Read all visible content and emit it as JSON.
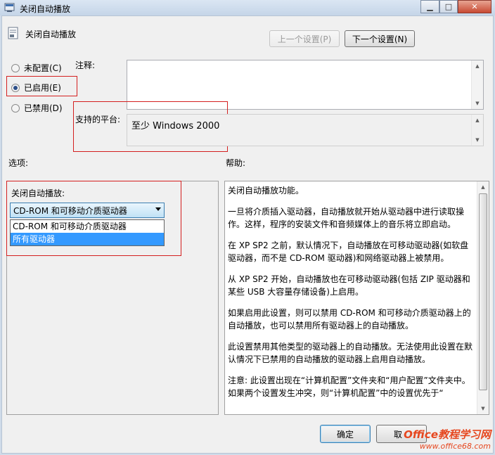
{
  "window": {
    "title": "关闭自动播放"
  },
  "policy": {
    "name": "关闭自动播放"
  },
  "nav": {
    "prev": "上一个设置(P)",
    "next": "下一个设置(N)"
  },
  "state": {
    "not_configured": "未配置(C)",
    "enabled": "已启用(E)",
    "disabled": "已禁用(D)",
    "selected": "enabled"
  },
  "comment": {
    "label": "注释:",
    "value": ""
  },
  "platform": {
    "label": "支持的平台:",
    "value": "至少 Windows 2000"
  },
  "options": {
    "header": "选项:",
    "label": "关闭自动播放:",
    "combo_value": "CD-ROM 和可移动介质驱动器",
    "dropdown_items": [
      "CD-ROM 和可移动介质驱动器",
      "所有驱动器"
    ],
    "dropdown_selected_index": 1
  },
  "help": {
    "header": "帮助:",
    "paragraphs": [
      "关闭自动播放功能。",
      "一旦将介质插入驱动器，自动播放就开始从驱动器中进行读取操作。这样，程序的安装文件和音频媒体上的音乐将立即启动。",
      "在 XP SP2 之前，默认情况下，自动播放在可移动驱动器(如软盘驱动器，而不是 CD-ROM 驱动器)和网络驱动器上被禁用。",
      "从 XP SP2 开始，自动播放也在可移动驱动器(包括 ZIP 驱动器和某些 USB 大容量存储设备)上启用。",
      "如果启用此设置，则可以禁用 CD-ROM 和可移动介质驱动器上的自动播放，也可以禁用所有驱动器上的自动播放。",
      "此设置禁用其他类型的驱动器上的自动播放。无法使用此设置在默认情况下已禁用的自动播放的驱动器上启用自动播放。",
      "注意: 此设置出现在“计算机配置”文件夹和“用户配置”文件夹中。如果两个设置发生冲突，则“计算机配置”中的设置优先于“"
    ]
  },
  "buttons": {
    "ok": "确定",
    "cancel": "取"
  },
  "watermark": {
    "main": "Office教程学习网",
    "url": "www.office68.com"
  },
  "colors": {
    "highlight_box": "#d41f1f",
    "selection": "#3399ff",
    "watermark": "#e6471f"
  }
}
